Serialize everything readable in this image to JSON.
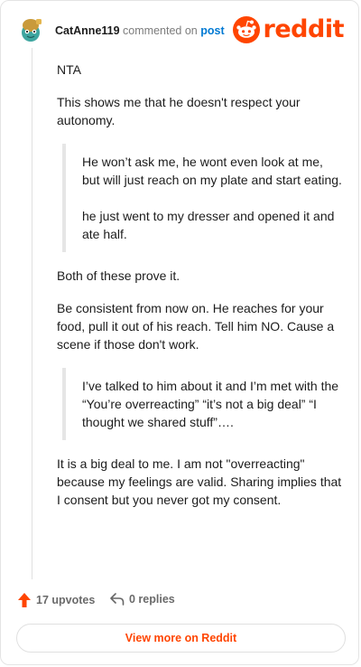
{
  "header": {
    "username": "CatAnne119",
    "commented_on": "commented on",
    "post_link": "post",
    "logo_text": "reddit"
  },
  "comment": {
    "paragraphs_1": [
      "NTA",
      "This shows me that he doesn't respect your autonomy."
    ],
    "quote_1": [
      "He won’t ask me, he wont even look at me, but will just reach on my plate and start eating.",
      "he just went to my dresser and opened it and ate half."
    ],
    "paragraphs_2": [
      "Both of these prove it.",
      "Be consistent from now on. He reaches for your food, pull it out of his reach. Tell him NO. Cause a scene if those don't work."
    ],
    "quote_2": [
      "I’ve talked to him about it and I’m met with the “You’re overreacting” “it’s not a big deal” “I thought we shared stuff”…."
    ],
    "paragraphs_3": [
      "It is a big deal to me. I am not \"overreacting\" because my feelings are valid. Sharing implies that I consent but you never got my consent."
    ]
  },
  "footer": {
    "upvotes": "17 upvotes",
    "replies": "0 replies",
    "view_more": "View more on Reddit"
  },
  "colors": {
    "brand": "#ff4500",
    "link": "#0079d3"
  },
  "icons": {
    "upvote": "upvote-arrow-icon",
    "reply": "reply-arrow-icon",
    "logo": "reddit-snoo-icon"
  }
}
